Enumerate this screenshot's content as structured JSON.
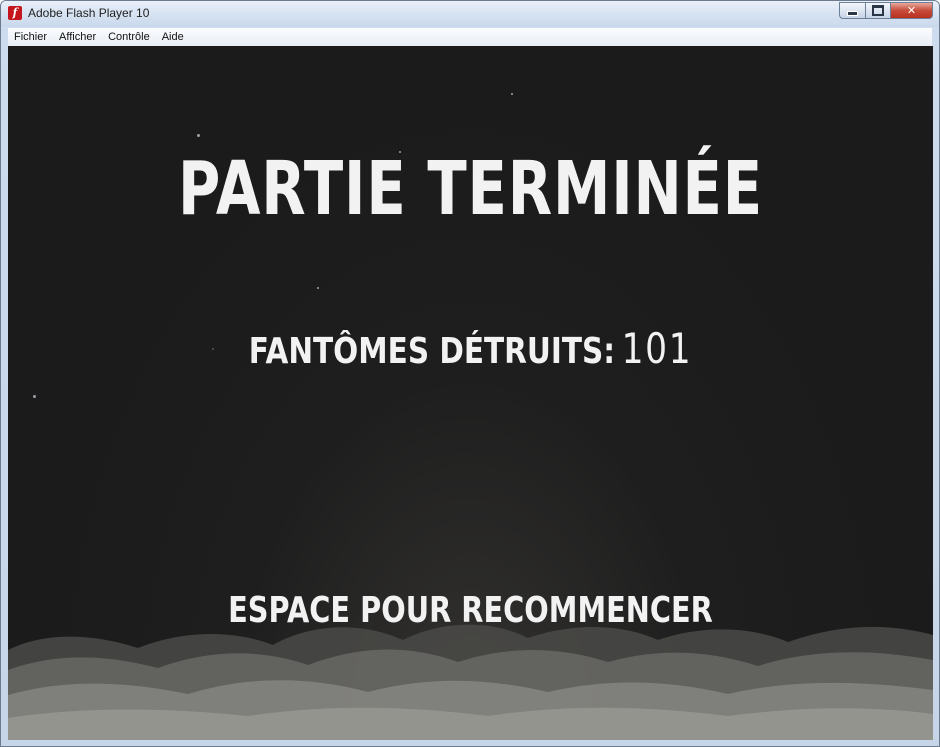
{
  "window": {
    "title": "Adobe Flash Player 10",
    "icon": "flash-player-icon",
    "icon_glyph": "f",
    "close_glyph": "✕"
  },
  "menu": {
    "items": [
      "Fichier",
      "Afficher",
      "Contrôle",
      "Aide"
    ]
  },
  "game": {
    "title": "PARTIE TERMINÉE",
    "score_label": "FANTÔMES DÉTRUITS:",
    "score_value": "101",
    "restart_prompt": "ESPACE POUR RECOMMENCER"
  },
  "colors": {
    "background": "#1b1b1b",
    "text": "#f2f2f2",
    "clouds": "#8a8a86"
  }
}
